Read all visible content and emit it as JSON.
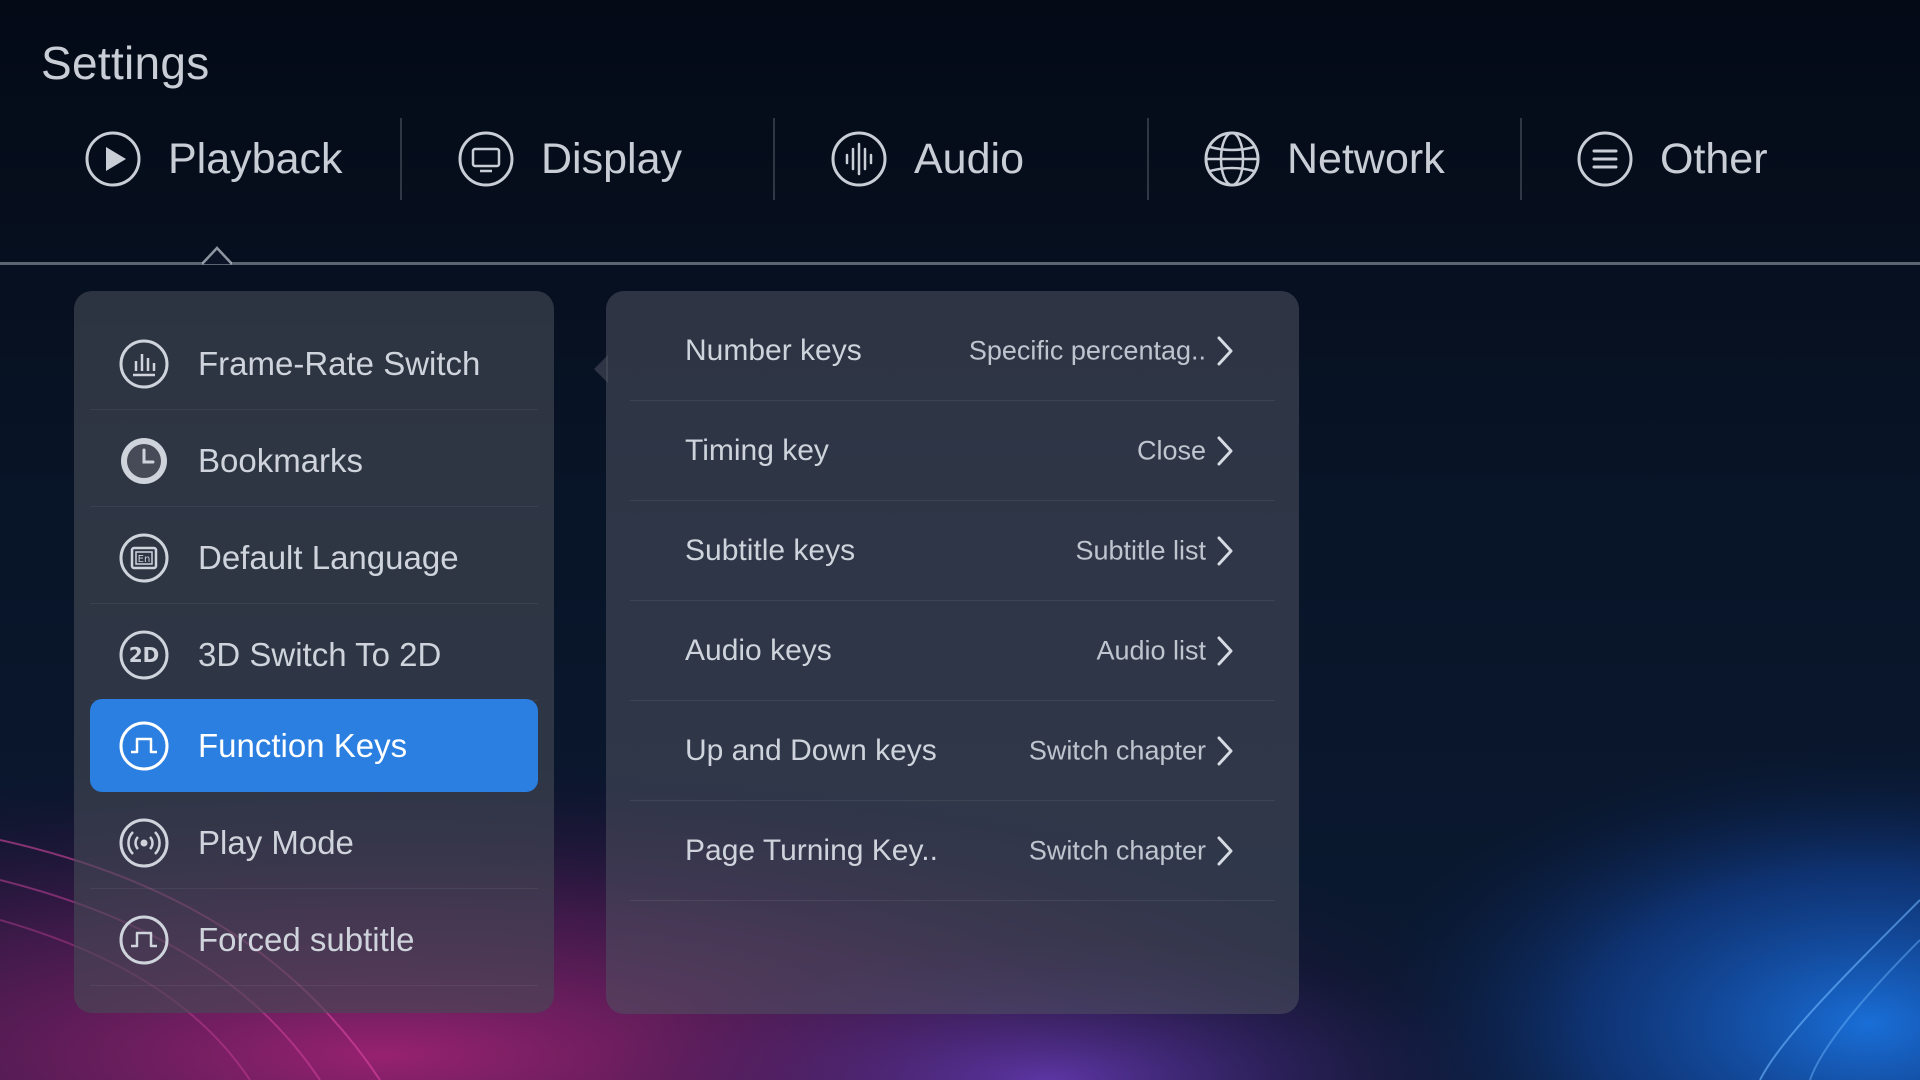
{
  "page": {
    "title": "Settings"
  },
  "tabs": [
    {
      "label": "Playback",
      "icon": "play-icon",
      "selected": true
    },
    {
      "label": "Display",
      "icon": "monitor-icon",
      "selected": false
    },
    {
      "label": "Audio",
      "icon": "audio-waveform-icon",
      "selected": false
    },
    {
      "label": "Network",
      "icon": "globe-icon",
      "selected": false
    },
    {
      "label": "Other",
      "icon": "menu-lines-icon",
      "selected": false
    }
  ],
  "menu": {
    "items": [
      {
        "label": "Frame-Rate Switch",
        "icon": "bar-chart-icon",
        "active": false
      },
      {
        "label": "Bookmarks",
        "icon": "clock-icon",
        "active": false
      },
      {
        "label": "Default Language",
        "icon": "language-en-icon",
        "active": false
      },
      {
        "label": "3D Switch To 2D",
        "icon": "2d-icon",
        "active": false
      },
      {
        "label": "Function Keys",
        "icon": "pulse-square-icon",
        "active": true
      },
      {
        "label": "Play Mode",
        "icon": "broadcast-icon",
        "active": false
      },
      {
        "label": "Forced subtitle",
        "icon": "pulse-square-icon",
        "active": false
      }
    ]
  },
  "settings": {
    "rows": [
      {
        "label": "Number keys",
        "value": "Specific percentag.."
      },
      {
        "label": "Timing key",
        "value": "Close"
      },
      {
        "label": "Subtitle keys",
        "value": "Subtitle list"
      },
      {
        "label": "Audio keys",
        "value": "Audio list"
      },
      {
        "label": "Up and Down keys",
        "value": "Switch chapter"
      },
      {
        "label": "Page Turning Key..",
        "value": "Switch chapter"
      }
    ]
  },
  "colors": {
    "accent": "#2a7fe0",
    "background": "#07101f",
    "text": "#cfd4dc"
  }
}
